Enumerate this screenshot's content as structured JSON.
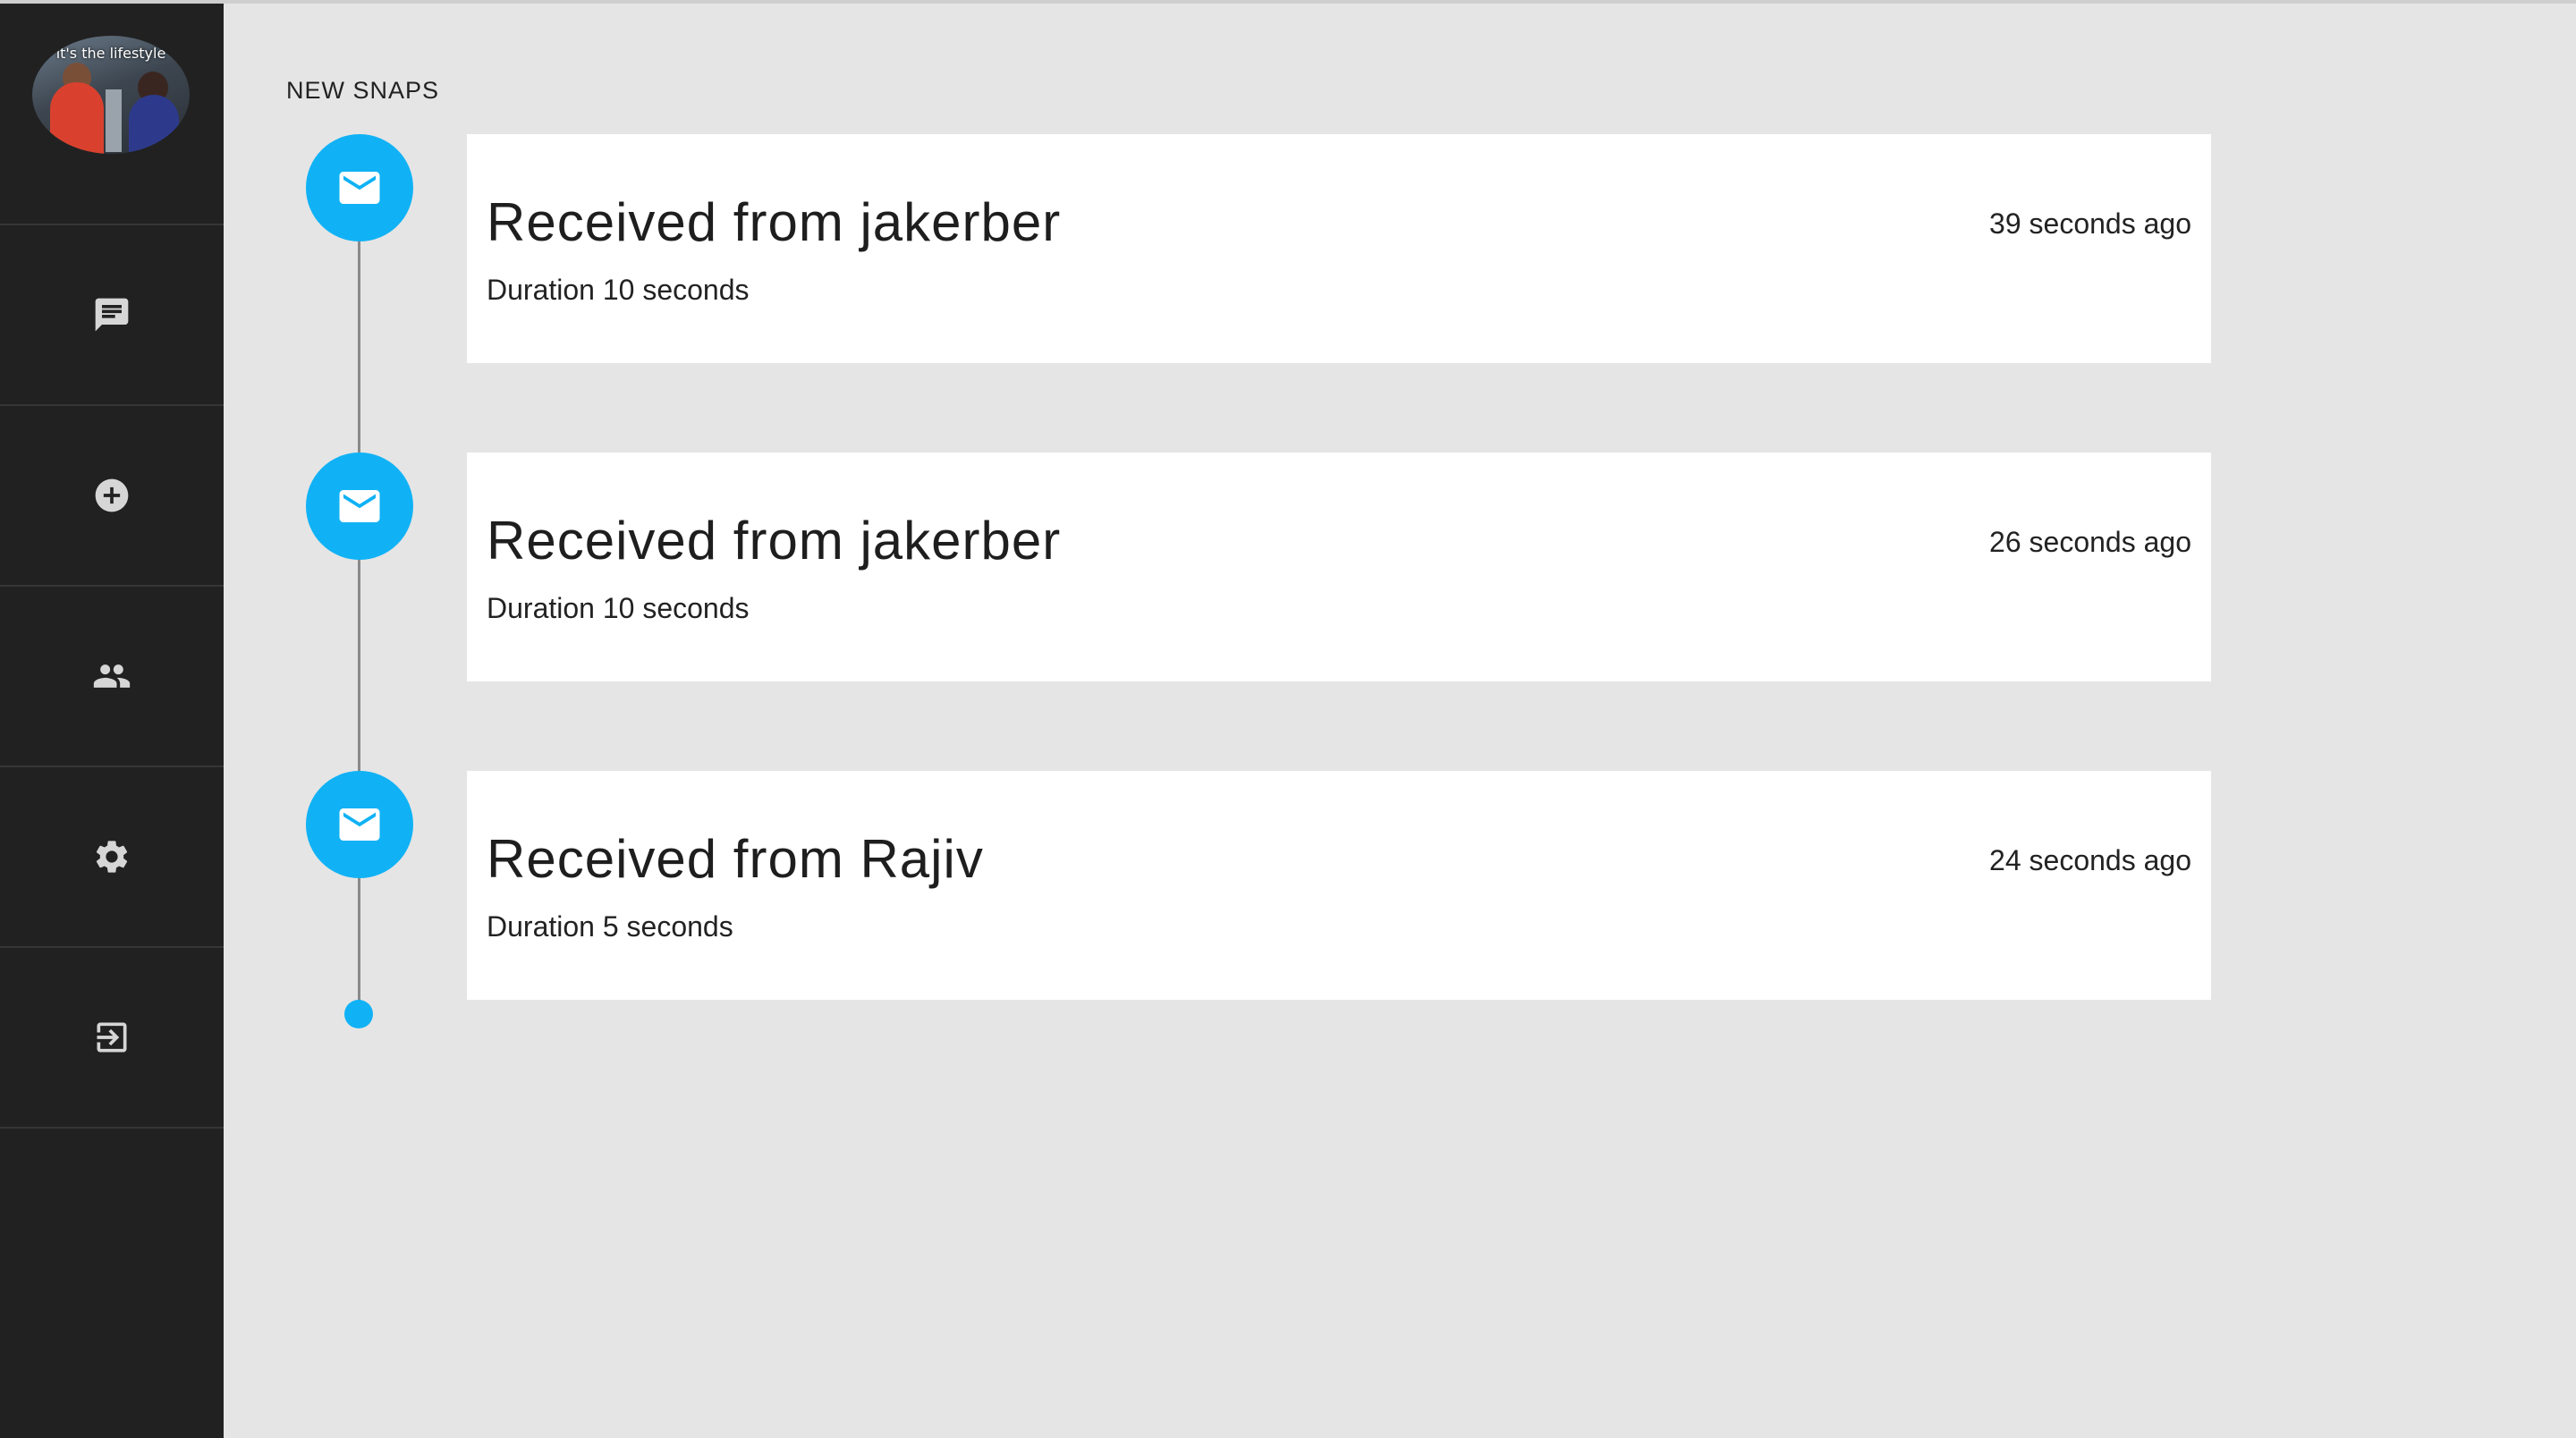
{
  "sidebar": {
    "avatar": {
      "caption": "it's the lifestyle"
    },
    "nav": [
      {
        "icon": "chat-icon",
        "name": "chat"
      },
      {
        "icon": "add-circle-icon",
        "name": "add"
      },
      {
        "icon": "people-icon",
        "name": "friends"
      },
      {
        "icon": "gear-icon",
        "name": "settings"
      },
      {
        "icon": "logout-icon",
        "name": "logout"
      }
    ]
  },
  "main": {
    "section_title": "NEW SNAPS",
    "snaps": [
      {
        "title": "Received from jakerber",
        "duration": "Duration 10 seconds",
        "time_ago": "39 seconds ago",
        "icon": "mail-icon"
      },
      {
        "title": "Received from jakerber",
        "duration": "Duration 10 seconds",
        "time_ago": "26 seconds ago",
        "icon": "mail-icon"
      },
      {
        "title": "Received from Rajiv",
        "duration": "Duration 5 seconds",
        "time_ago": "24 seconds ago",
        "icon": "mail-icon"
      }
    ]
  },
  "colors": {
    "sidebar_bg": "#212121",
    "main_bg": "#e5e5e5",
    "accent": "#10b2f5",
    "card_bg": "#ffffff"
  }
}
